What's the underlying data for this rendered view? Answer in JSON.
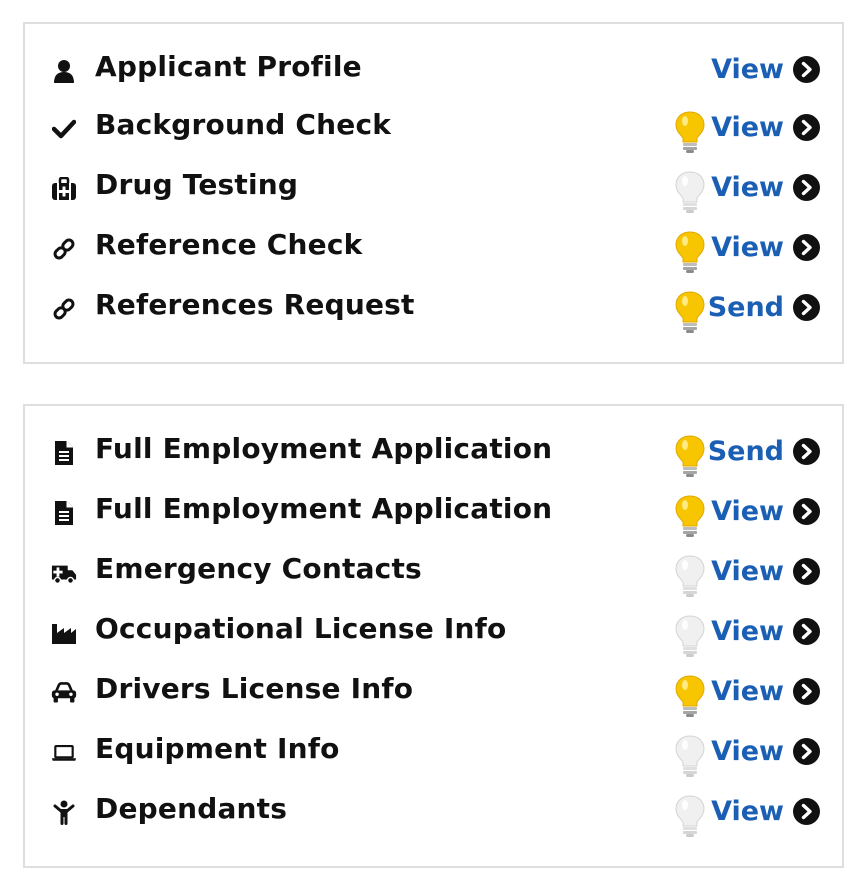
{
  "section1": {
    "items": [
      {
        "label": "Applicant Profile",
        "icon": "user-icon",
        "bulb": "none",
        "action": "View"
      },
      {
        "label": "Background Check",
        "icon": "checkmark-icon",
        "bulb": "on",
        "action": "View"
      },
      {
        "label": "Drug Testing",
        "icon": "medkit-icon",
        "bulb": "off",
        "action": "View"
      },
      {
        "label": "Reference Check",
        "icon": "link-icon",
        "bulb": "on",
        "action": "View"
      },
      {
        "label": "References Request",
        "icon": "link-icon",
        "bulb": "on",
        "action": "Send"
      }
    ]
  },
  "section2": {
    "items": [
      {
        "label": "Full Employment Application",
        "icon": "document-icon",
        "bulb": "on",
        "action": "Send"
      },
      {
        "label": "Full Employment Application",
        "icon": "document-icon",
        "bulb": "on",
        "action": "View"
      },
      {
        "label": "Emergency Contacts",
        "icon": "ambulance-icon",
        "bulb": "off",
        "action": "View"
      },
      {
        "label": "Occupational License Info",
        "icon": "industry-icon",
        "bulb": "off",
        "action": "View"
      },
      {
        "label": "Drivers License Info",
        "icon": "car-icon",
        "bulb": "on",
        "action": "View"
      },
      {
        "label": "Equipment Info",
        "icon": "laptop-icon",
        "bulb": "off",
        "action": "View"
      },
      {
        "label": "Dependants",
        "icon": "child-icon",
        "bulb": "off",
        "action": "View"
      }
    ]
  },
  "colors": {
    "link": "#1a5fb4",
    "bulb_on": "#f7c600",
    "bulb_off": "#e6e6e6",
    "border": "#dedede"
  }
}
